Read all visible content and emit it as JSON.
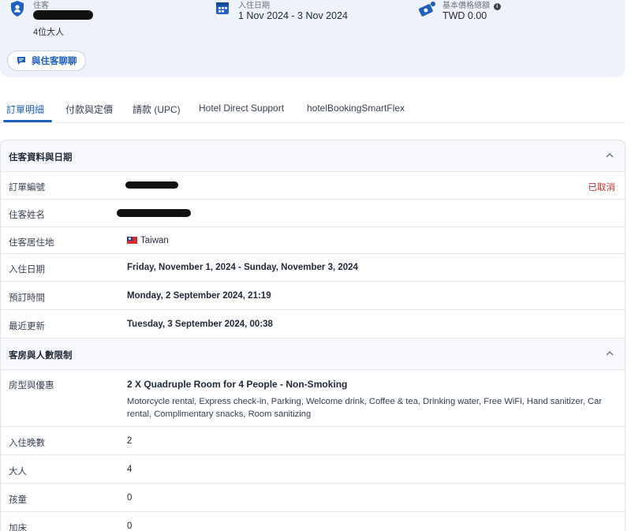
{
  "summary": {
    "guest": {
      "label": "住客",
      "sub": "4位大人"
    },
    "dates": {
      "label": "入住日期",
      "value": "1 Nov 2024 - 3 Nov 2024"
    },
    "price": {
      "label": "基本價格總額",
      "value": "TWD 0.00"
    },
    "chat_button": "與住客聊聊"
  },
  "tabs": [
    {
      "label": "訂單明細",
      "active": true
    },
    {
      "label": "付款與定價"
    },
    {
      "label": "請款 (UPC)"
    },
    {
      "label": "Hotel Direct Support"
    },
    {
      "label": "hotelBookingSmartFlex"
    }
  ],
  "section_guest": {
    "title": "住客資料與日期",
    "rows": [
      {
        "key": "訂單編號",
        "status": "已取消"
      },
      {
        "key": "住客姓名"
      },
      {
        "key": "住客居住地",
        "value": "Taiwan"
      },
      {
        "key": "入住日期",
        "value": "Friday, November 1, 2024 - Sunday, November 3, 2024"
      },
      {
        "key": "預訂時間",
        "value": "Monday, 2 September 2024, 21:19"
      },
      {
        "key": "最近更新",
        "value": "Tuesday, 3 September 2024, 00:38"
      }
    ]
  },
  "section_room": {
    "title": "客房與人數限制",
    "room_type": {
      "key": "房型與優惠",
      "value": "2 X Quadruple Room for 4 People - Non-Smoking",
      "amenities": "Motorcycle rental, Express check-in, Parking, Welcome drink, Coffee & tea, Drinking water, Free WiFi, Hand sanitizer, Car rental, Complimentary snacks, Room sanitizing"
    },
    "rows": [
      {
        "key": "入住晚數",
        "value": "2"
      },
      {
        "key": "大人",
        "value": "4"
      },
      {
        "key": "孩童",
        "value": "0"
      },
      {
        "key": "加床",
        "value": "0"
      }
    ]
  },
  "colors": {
    "accent": "#1f5fbf",
    "cancelled": "#d0312d",
    "summary_bg": "#eef2fa"
  }
}
